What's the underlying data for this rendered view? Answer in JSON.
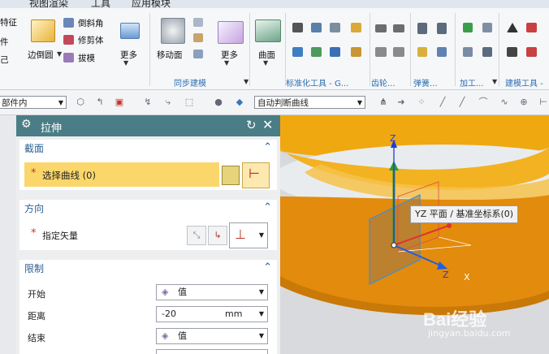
{
  "menu": {
    "items": [
      "视图",
      "渲染",
      "工具",
      "应用模块"
    ]
  },
  "ribbon": {
    "left_partial": [
      "特征",
      "件",
      "己"
    ],
    "edge_blend": "边倒圆",
    "chamfer": "倒斜角",
    "trim_body": "修剪体",
    "draft": "拔模",
    "more1": "更多",
    "move_face": "移动面",
    "more2": "更多",
    "surface": "曲面",
    "group_sync": "同步建模",
    "group_std": "标准化工具 - G...",
    "group_gear": "齿轮...",
    "group_spring": "弹簧...",
    "group_machining": "加工...",
    "group_modeling_tools": "建模工具 -"
  },
  "toolbar2": {
    "filter_value": "部件内",
    "curve_rule": "自动判断曲线"
  },
  "dialog": {
    "title": "拉伸",
    "section": {
      "title": "截面",
      "select_curve": "选择曲线 (0)"
    },
    "direction": {
      "title": "方向",
      "specify_vector": "指定矢量"
    },
    "limits": {
      "title": "限制",
      "start_label": "开始",
      "start_value": "值",
      "distance_label": "距离",
      "distance_value": "-20",
      "distance_unit": "mm",
      "end_label": "结束",
      "end_value": "值"
    }
  },
  "viewport": {
    "tooltip": "YZ 平面 / 基准坐标系(0)",
    "axis_z": "Z",
    "axis_z2": "Z",
    "axis_x": "X",
    "watermark": "Bai经验",
    "watermark_url": "jingyan.baidu.com"
  },
  "colors": {
    "dialog_title_bg": "#4a7d86",
    "highlight_row": "#fbd76b",
    "model_orange": "#e08a0c",
    "section_text": "#2c5f93"
  }
}
